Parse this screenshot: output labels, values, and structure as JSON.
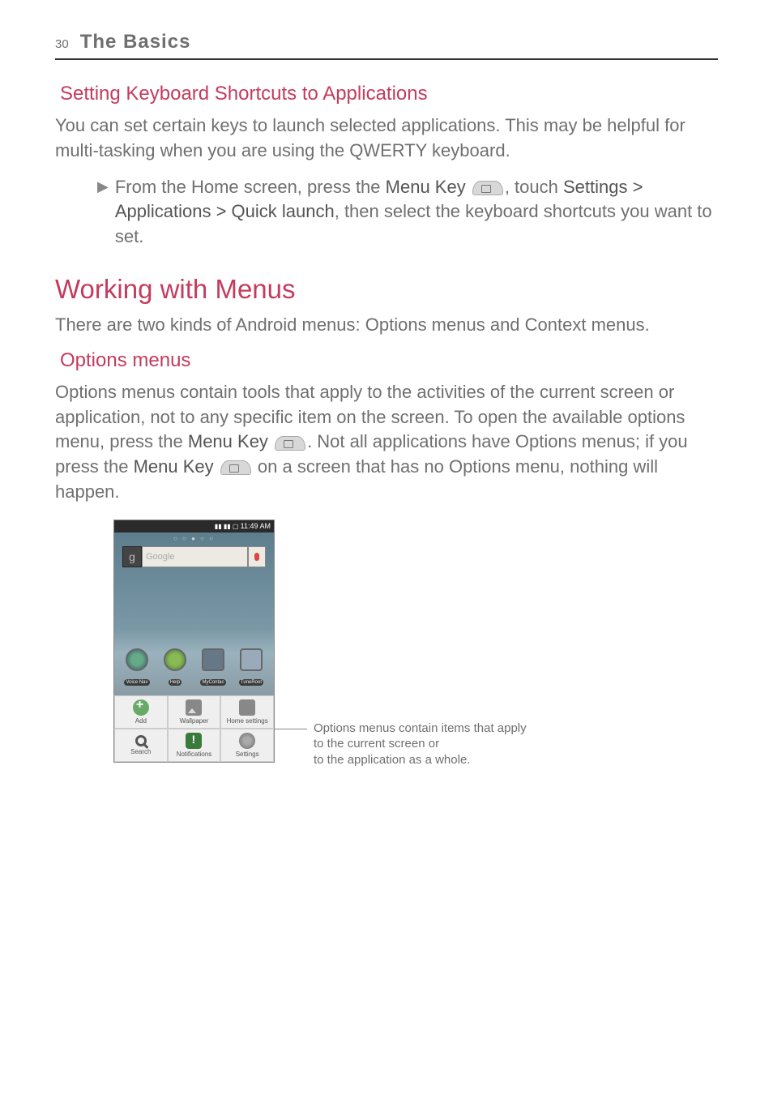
{
  "header": {
    "page_number": "30",
    "chapter": "The Basics"
  },
  "section1": {
    "title": "Setting Keyboard Shortcuts to Applications",
    "body": "You can set certain keys to launch selected applications. This may be helpful for multi-tasking when you are using the QWERTY keyboard.",
    "bullet_pre": "From the Home screen, press the ",
    "bullet_menu_key": "Menu Key",
    "bullet_mid": ", touch ",
    "bullet_path": "Settings > Applications > Quick launch",
    "bullet_post": ", then select the keyboard shortcuts you want to set."
  },
  "main_heading": "Working with Menus",
  "main_body": "There are two kinds of Android menus: Options menus and Context menus.",
  "section2": {
    "title": "Options menus",
    "body_pre": "Options menus contain tools that apply to the activities of the current screen or application, not to any specific item on the screen. To open the available options menu, press the ",
    "menu_key1": "Menu Key",
    "body_mid": ". Not all applications have Options menus; if you press the ",
    "menu_key2": "Menu Key",
    "body_post": " on a screen that has no Options menu, nothing will happen."
  },
  "screenshot": {
    "time": "11:49 AM",
    "search_placeholder": "Google",
    "apps": {
      "nav": "Voice Nav",
      "help": "Help",
      "contacts": "MyContac",
      "tune": "TuneRoot"
    },
    "menu": {
      "add": "Add",
      "wallpaper": "Wallpaper",
      "home_settings": "Home settings",
      "search": "Search",
      "notifications": "Notifications",
      "settings": "Settings"
    }
  },
  "callout": {
    "line1": "Options menus contain items that apply",
    "line2": "to the current screen or",
    "line3": "to the application as a whole."
  }
}
